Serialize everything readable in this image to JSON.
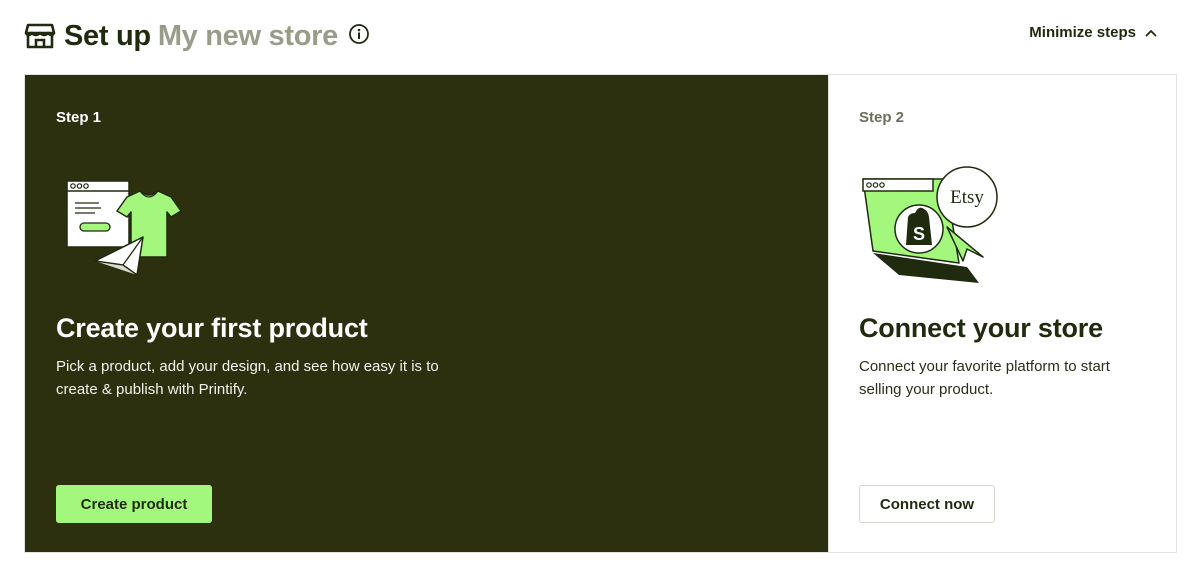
{
  "header": {
    "title_prefix": "Set up",
    "store_name": "My new store",
    "minimize_label": "Minimize steps",
    "icons": {
      "store": "store-icon",
      "info": "info-icon",
      "collapse": "chevron-up-icon"
    }
  },
  "steps": [
    {
      "step_label": "Step 1",
      "title": "Create your first product",
      "description": "Pick a product, add your design, and see how easy it is to create & publish with Printify.",
      "button_label": "Create product",
      "illustration": "product-design-illustration"
    },
    {
      "step_label": "Step 2",
      "title": "Connect your store",
      "description": "Connect your favorite platform to start selling your product.",
      "button_label": "Connect now",
      "illustration": "store-platforms-illustration",
      "badge_text": "Etsy"
    }
  ],
  "colors": {
    "dark_card": "#2d300f",
    "accent_green": "#a3f77c",
    "text_dark": "#1f2a0e",
    "muted": "#9a9c8a"
  }
}
